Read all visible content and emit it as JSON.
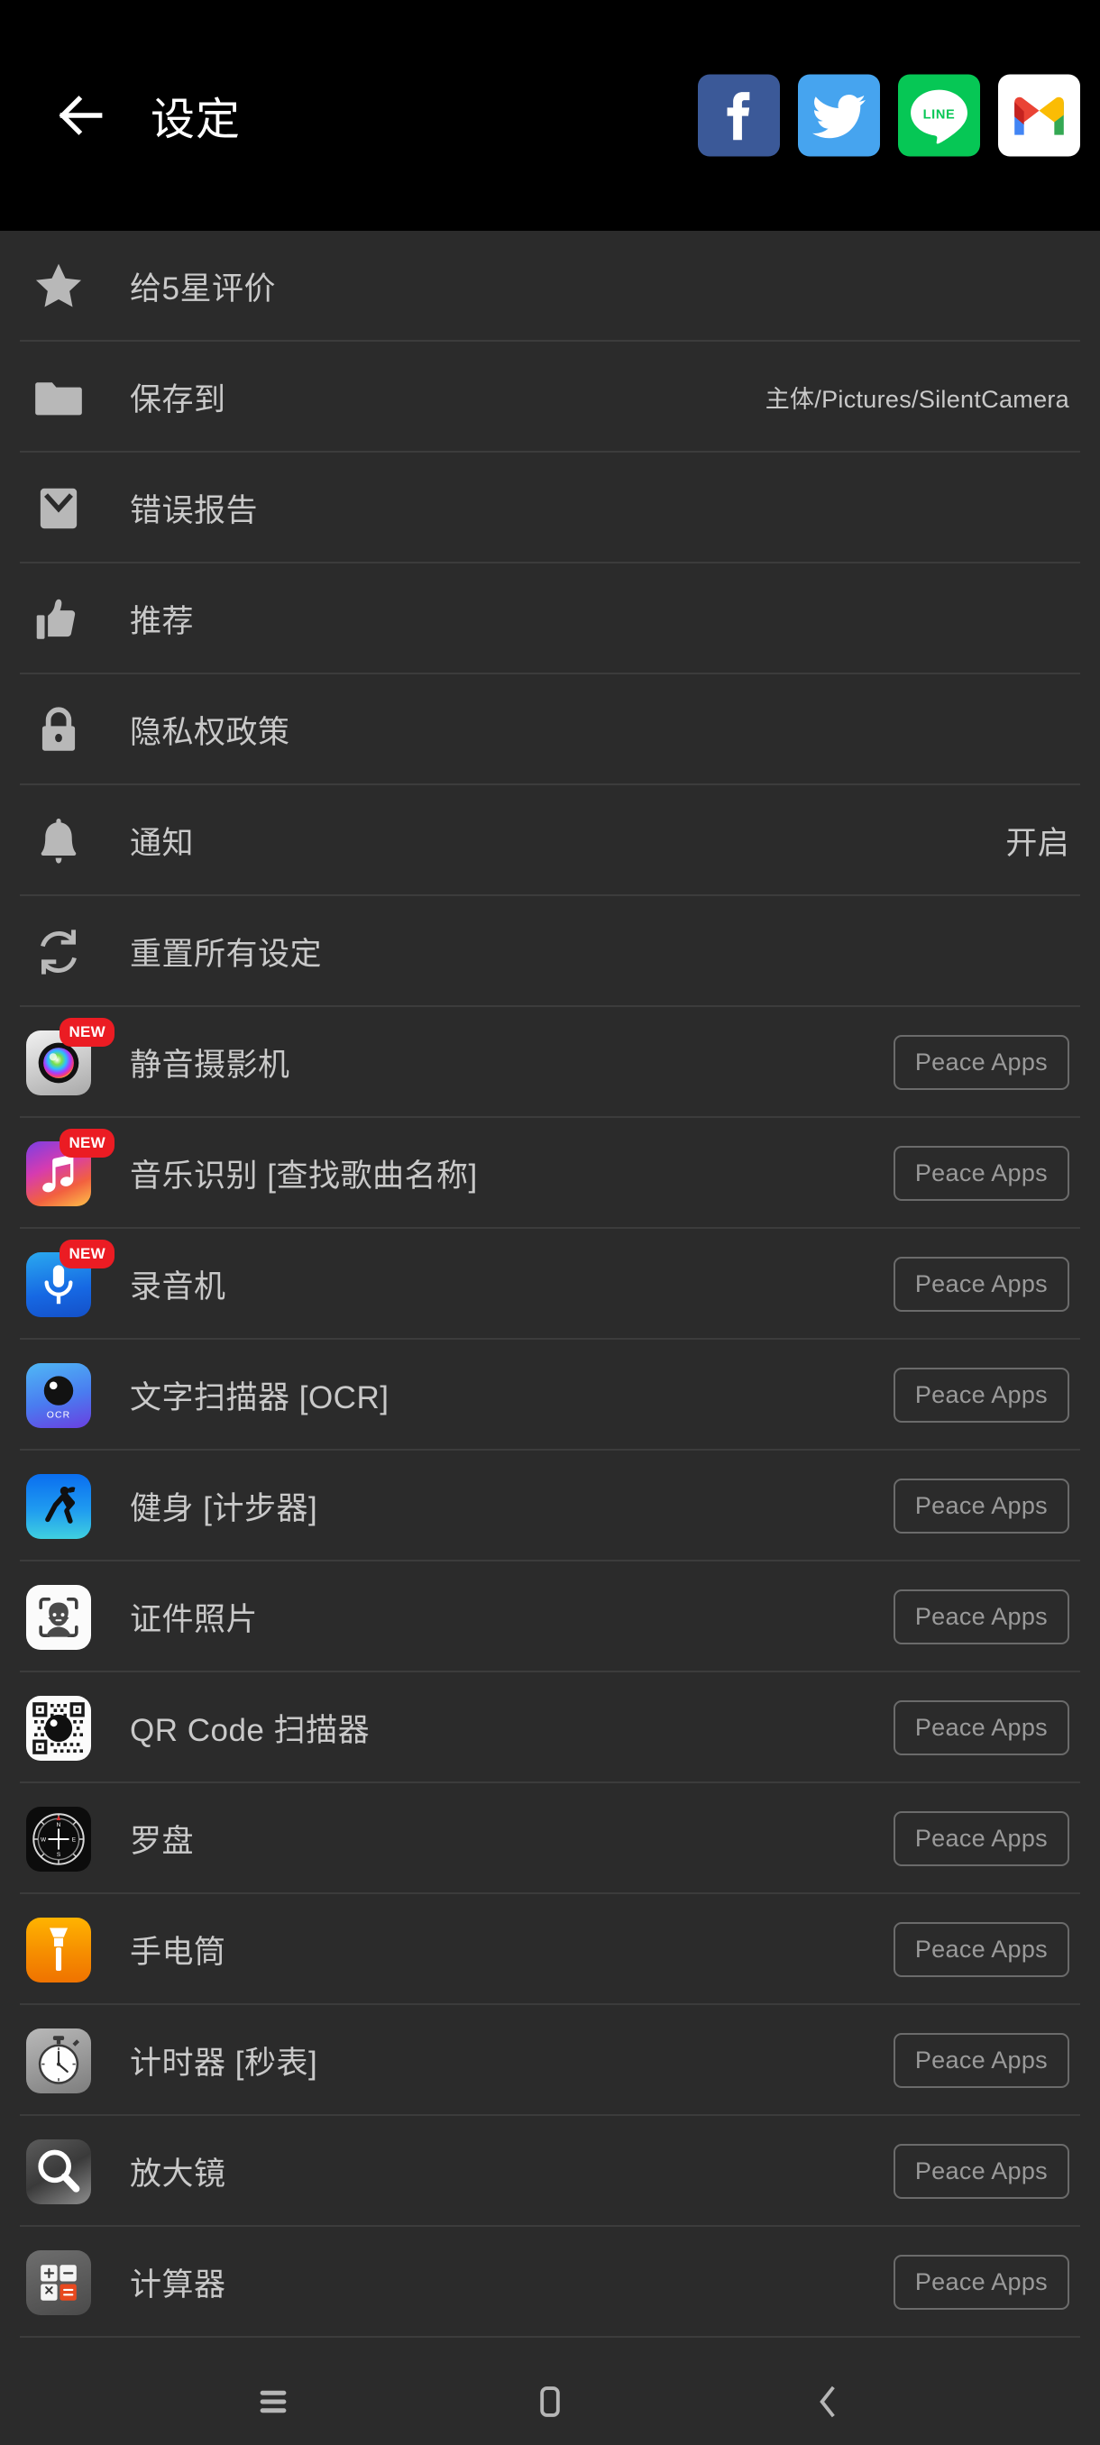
{
  "header": {
    "title": "设定",
    "back_icon": "arrow-left-icon",
    "social": [
      {
        "name": "facebook-icon",
        "label": "f",
        "color": "#3b5998"
      },
      {
        "name": "twitter-icon",
        "label": "",
        "color": "#46a4ef"
      },
      {
        "name": "line-icon",
        "label": "LINE",
        "color": "#06c755"
      },
      {
        "name": "gmail-icon",
        "label": "M",
        "color": "#ffffff"
      }
    ]
  },
  "settings_rows": [
    {
      "icon": "star-icon",
      "label": "给5星评价",
      "value": ""
    },
    {
      "icon": "folder-icon",
      "label": "保存到",
      "value": "主体/Pictures/SilentCamera"
    },
    {
      "icon": "envelope-icon",
      "label": "错误报告",
      "value": ""
    },
    {
      "icon": "thumbs-up-icon",
      "label": "推荐",
      "value": ""
    },
    {
      "icon": "lock-icon",
      "label": "隐私权政策",
      "value": ""
    },
    {
      "icon": "bell-icon",
      "label": "通知",
      "value": "开启"
    },
    {
      "icon": "refresh-icon",
      "label": "重置所有设定",
      "value": ""
    }
  ],
  "app_rows": [
    {
      "icon": "silent-camera-icon",
      "label": "静音摄影机",
      "badge": "NEW",
      "button": "Peace Apps"
    },
    {
      "icon": "music-note-icon",
      "label": "音乐识别 [查找歌曲名称]",
      "badge": "NEW",
      "button": "Peace Apps"
    },
    {
      "icon": "microphone-icon",
      "label": "录音机",
      "badge": "NEW",
      "button": "Peace Apps"
    },
    {
      "icon": "ocr-scanner-icon",
      "label": "文字扫描器 [OCR]",
      "badge": "",
      "button": "Peace Apps"
    },
    {
      "icon": "fitness-icon",
      "label": "健身 [计步器]",
      "badge": "",
      "button": "Peace Apps"
    },
    {
      "icon": "id-photo-icon",
      "label": "证件照片",
      "badge": "",
      "button": "Peace Apps"
    },
    {
      "icon": "qr-code-icon",
      "label": "QR Code 扫描器",
      "badge": "",
      "button": "Peace Apps"
    },
    {
      "icon": "compass-icon",
      "label": "罗盘",
      "badge": "",
      "button": "Peace Apps"
    },
    {
      "icon": "flashlight-icon",
      "label": "手电筒",
      "badge": "",
      "button": "Peace Apps"
    },
    {
      "icon": "stopwatch-icon",
      "label": "计时器 [秒表]",
      "badge": "",
      "button": "Peace Apps"
    },
    {
      "icon": "magnifier-icon",
      "label": "放大镜",
      "badge": "",
      "button": "Peace Apps"
    },
    {
      "icon": "calculator-icon",
      "label": "计算器",
      "badge": "",
      "button": "Peace Apps"
    }
  ],
  "navbar": {
    "recents": "recents-icon",
    "home": "home-icon",
    "back": "back-icon"
  },
  "colors": {
    "header_bg": "#000000",
    "list_bg": "#2b2b2b",
    "divider": "#3c3c3c",
    "text": "#c9c9c9",
    "badge_red": "#eb1c23",
    "button_border": "#6b6b6b"
  }
}
